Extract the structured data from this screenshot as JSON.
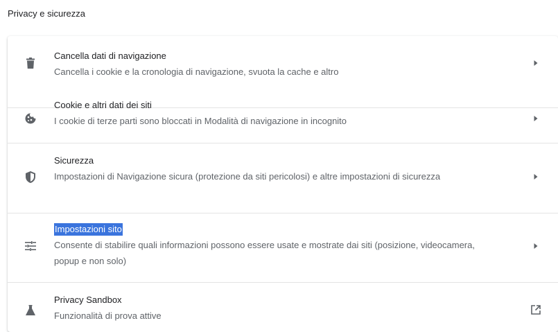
{
  "section": {
    "title": "Privacy e sicurezza"
  },
  "rows": [
    {
      "title": "Cancella dati di navigazione",
      "subtitle": "Cancella i cookie e la cronologia di navigazione, svuota la cache e altro",
      "icon": "trash-icon",
      "action_icon": "arrow-right-icon"
    },
    {
      "title": "Cookie e altri dati dei siti",
      "subtitle": "I cookie di terze parti sono bloccati in Modalità di navigazione in incognito",
      "icon": "cookie-icon",
      "action_icon": "arrow-right-icon"
    },
    {
      "title": "Sicurezza",
      "subtitle": "Impostazioni di Navigazione sicura (protezione da siti pericolosi) e altre impostazioni di sicurezza",
      "icon": "shield-icon",
      "action_icon": "arrow-right-icon"
    },
    {
      "title": "Impostazioni sito",
      "subtitle": "Consente di stabilire quali informazioni possono essere usate e mostrate dai siti (posizione, videocamera, popup e non solo)",
      "icon": "tune-icon",
      "action_icon": "arrow-right-icon",
      "title_selected": true
    },
    {
      "title": "Privacy Sandbox",
      "subtitle": "Funzionalità di prova attive",
      "icon": "flask-icon",
      "action_icon": "open-in-new-icon"
    }
  ],
  "colors": {
    "text_primary": "#202124",
    "text_secondary": "#5f6368",
    "icon": "#5f6368",
    "selection": "#3a74dd",
    "divider": "#e3e3e3"
  }
}
